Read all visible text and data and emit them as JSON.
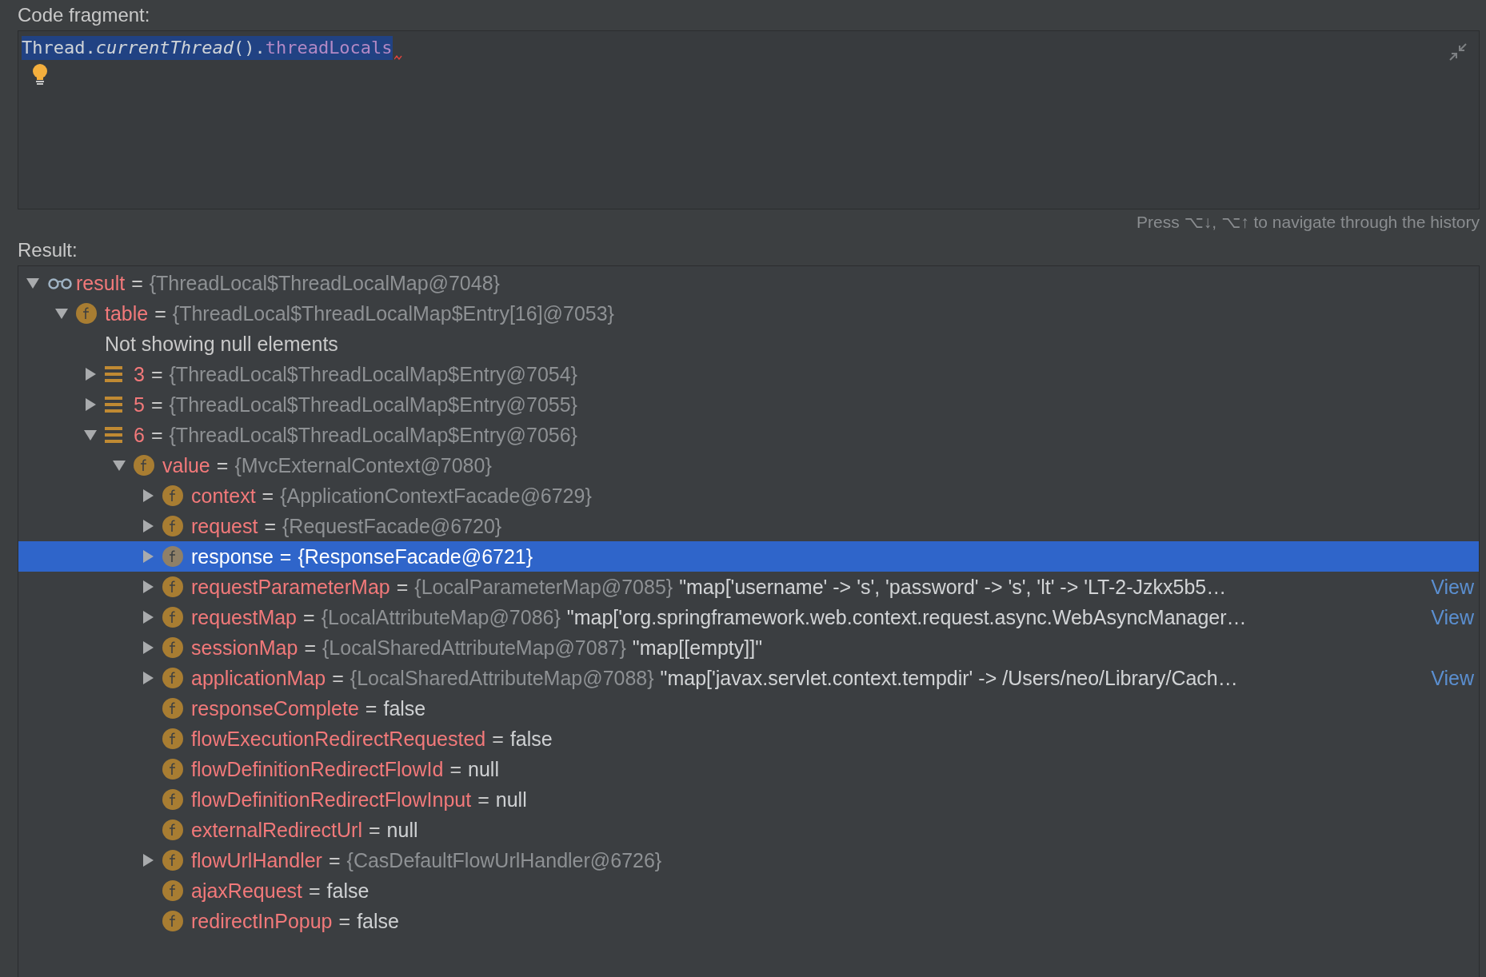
{
  "code_section": {
    "label": "Code fragment:",
    "code": [
      {
        "kind": "plain",
        "text": "Thread."
      },
      {
        "kind": "italic",
        "text": "currentThread"
      },
      {
        "kind": "plain",
        "text": "()."
      },
      {
        "kind": "member",
        "text": "threadLocals"
      }
    ],
    "selected": true,
    "error_mark": true,
    "hint": "Press ⌥↓, ⌥↑ to navigate through the history"
  },
  "result_section": {
    "label": "Result:",
    "tree": [
      {
        "kind": "watch",
        "name": "result",
        "op": "=",
        "value": "{ThreadLocal$ThreadLocalMap@7048}",
        "greyed": true,
        "expanded": true,
        "selected": false,
        "children": [
          {
            "kind": "field",
            "name": "table",
            "op": "=",
            "value": "{ThreadLocal$ThreadLocalMap$Entry[16]@7053}",
            "greyed": true,
            "expanded": true,
            "selected": false,
            "children": [
              {
                "kind": "message",
                "name": "Not showing null elements",
                "selected": false
              },
              {
                "kind": "element",
                "name": "3",
                "op": "=",
                "value": "{ThreadLocal$ThreadLocalMap$Entry@7054}",
                "greyed": true,
                "expanded": false,
                "selected": false
              },
              {
                "kind": "element",
                "name": "5",
                "op": "=",
                "value": "{ThreadLocal$ThreadLocalMap$Entry@7055}",
                "greyed": true,
                "expanded": false,
                "selected": false
              },
              {
                "kind": "element",
                "name": "6",
                "op": "=",
                "value": "{ThreadLocal$ThreadLocalMap$Entry@7056}",
                "greyed": true,
                "expanded": true,
                "selected": false,
                "children": [
                  {
                    "kind": "field",
                    "name": "value",
                    "op": "=",
                    "value": "{MvcExternalContext@7080}",
                    "greyed": true,
                    "expanded": true,
                    "selected": false,
                    "children": [
                      {
                        "kind": "field",
                        "name": "context",
                        "op": "=",
                        "value": "{ApplicationContextFacade@6729}",
                        "greyed": true,
                        "expanded": false,
                        "selected": false
                      },
                      {
                        "kind": "field",
                        "name": "request",
                        "op": "=",
                        "value": "{RequestFacade@6720}",
                        "greyed": true,
                        "expanded": false,
                        "selected": false
                      },
                      {
                        "kind": "field",
                        "name": "response",
                        "op": "=",
                        "value": "{ResponseFacade@6721}",
                        "greyed": true,
                        "expanded": false,
                        "selected": true
                      },
                      {
                        "kind": "field",
                        "name": "requestParameterMap",
                        "op": "=",
                        "value": "{LocalParameterMap@7085}",
                        "greyed": true,
                        "detail": "\"map['username' -> 's', 'password' -> 's', 'lt' -> 'LT-2-Jzkx5b5…",
                        "link": "View",
                        "expanded": false,
                        "selected": false
                      },
                      {
                        "kind": "field",
                        "name": "requestMap",
                        "op": "=",
                        "value": "{LocalAttributeMap@7086}",
                        "greyed": true,
                        "detail": "\"map['org.springframework.web.context.request.async.WebAsyncManager…",
                        "link": "View",
                        "expanded": false,
                        "selected": false
                      },
                      {
                        "kind": "field",
                        "name": "sessionMap",
                        "op": "=",
                        "value": "{LocalSharedAttributeMap@7087}",
                        "greyed": true,
                        "detail": "\"map[[empty]]\"",
                        "expanded": false,
                        "selected": false
                      },
                      {
                        "kind": "field",
                        "name": "applicationMap",
                        "op": "=",
                        "value": "{LocalSharedAttributeMap@7088}",
                        "greyed": true,
                        "detail": "\"map['javax.servlet.context.tempdir' -> /Users/neo/Library/Cach…",
                        "link": "View",
                        "expanded": false,
                        "selected": false
                      },
                      {
                        "kind": "field",
                        "name": "responseComplete",
                        "op": "=",
                        "value": "false",
                        "greyed": false,
                        "selected": false
                      },
                      {
                        "kind": "field",
                        "name": "flowExecutionRedirectRequested",
                        "op": "=",
                        "value": "false",
                        "greyed": false,
                        "selected": false
                      },
                      {
                        "kind": "field",
                        "name": "flowDefinitionRedirectFlowId",
                        "op": "=",
                        "value": "null",
                        "greyed": false,
                        "selected": false
                      },
                      {
                        "kind": "field",
                        "name": "flowDefinitionRedirectFlowInput",
                        "op": "=",
                        "value": "null",
                        "greyed": false,
                        "selected": false
                      },
                      {
                        "kind": "field",
                        "name": "externalRedirectUrl",
                        "op": "=",
                        "value": "null",
                        "greyed": false,
                        "selected": false
                      },
                      {
                        "kind": "field",
                        "name": "flowUrlHandler",
                        "op": "=",
                        "value": "{CasDefaultFlowUrlHandler@6726}",
                        "greyed": true,
                        "expanded": false,
                        "selected": false
                      },
                      {
                        "kind": "field",
                        "name": "ajaxRequest",
                        "op": "=",
                        "value": "false",
                        "greyed": false,
                        "selected": false
                      },
                      {
                        "kind": "field",
                        "name": "redirectInPopup",
                        "op": "=",
                        "value": "false",
                        "greyed": false,
                        "selected": false
                      }
                    ]
                  }
                ]
              }
            ]
          }
        ]
      }
    ]
  }
}
